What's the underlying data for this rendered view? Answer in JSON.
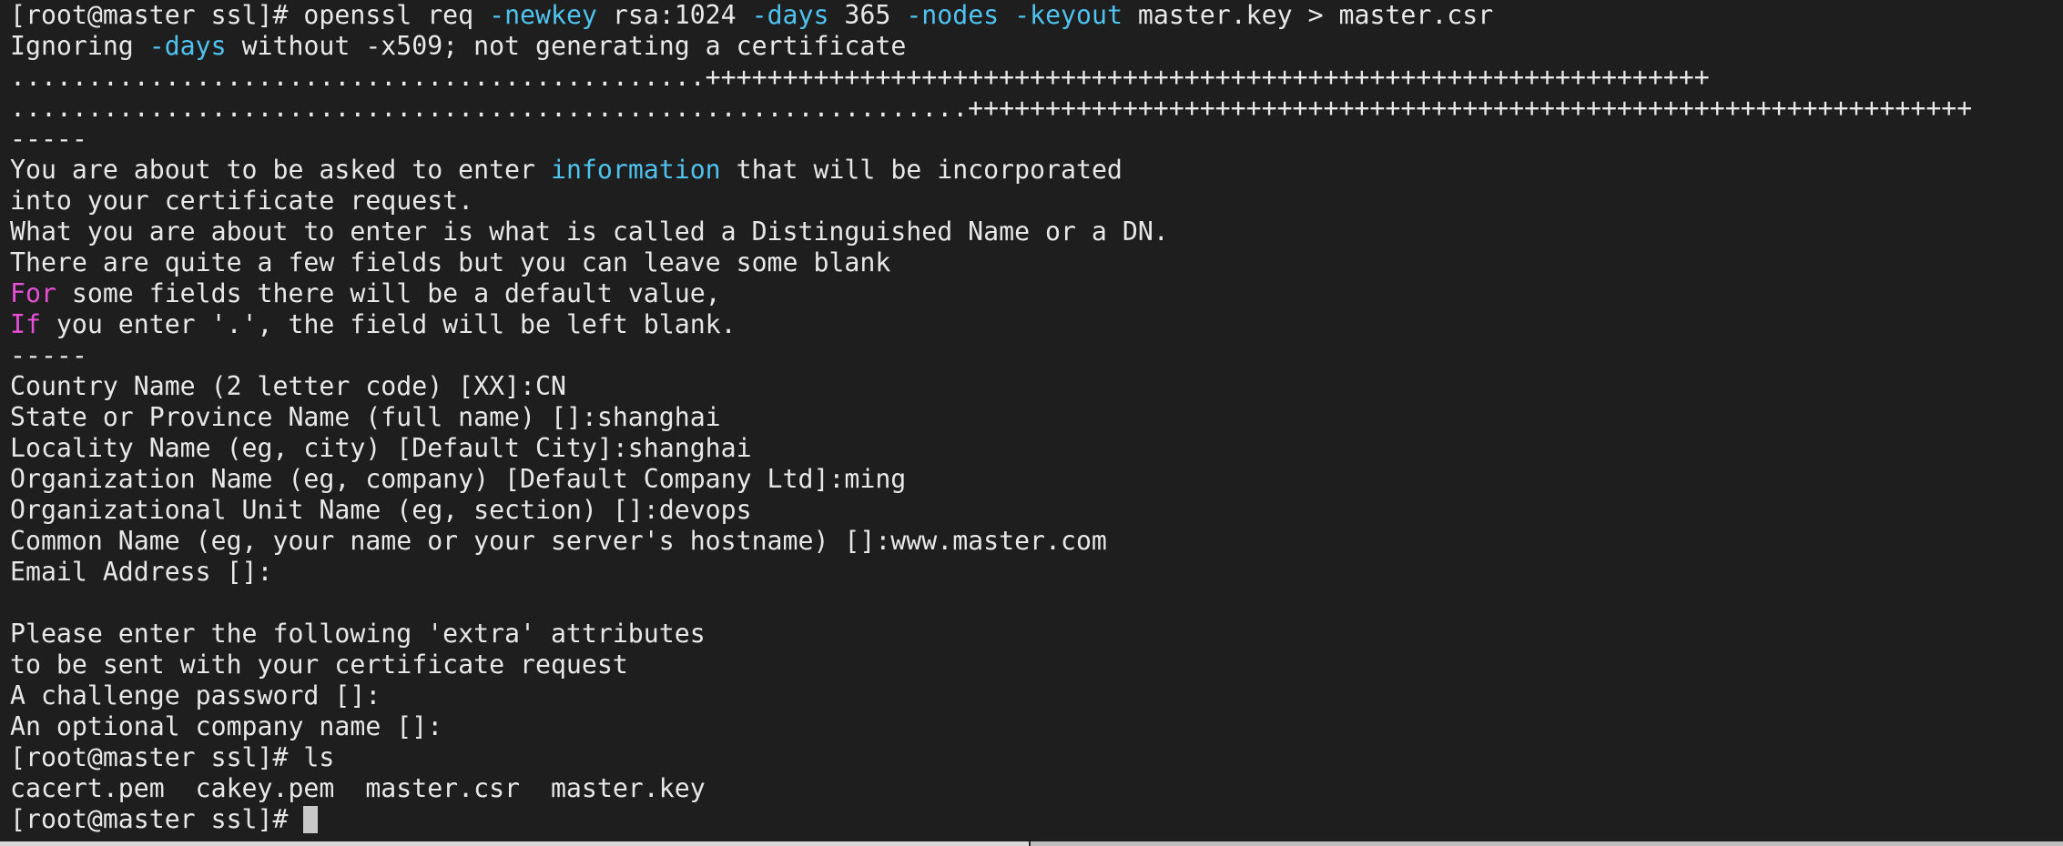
{
  "terminal": {
    "lines": [
      [
        [
          "n",
          "[root@master ssl]# openssl req "
        ],
        [
          "c",
          "-newkey"
        ],
        [
          "n",
          " rsa:1024 "
        ],
        [
          "c",
          "-days"
        ],
        [
          "n",
          " 365 "
        ],
        [
          "c",
          "-nodes"
        ],
        [
          "n",
          " "
        ],
        [
          "c",
          "-keyout"
        ],
        [
          "n",
          " master.key > master.csr"
        ]
      ],
      [
        [
          "n",
          "Ignoring "
        ],
        [
          "c",
          "-days"
        ],
        [
          "n",
          " without -x509; not generating a certificate"
        ]
      ],
      [
        [
          "n",
          ".............................................+++++++++++++++++++++++++++++++++++++++++++++++++++++++++++++++++"
        ]
      ],
      [
        [
          "n",
          "..............................................................+++++++++++++++++++++++++++++++++++++++++++++++++++++++++++++++++"
        ]
      ],
      [
        [
          "n",
          "-----"
        ]
      ],
      [
        [
          "n",
          "You are about to be asked to enter "
        ],
        [
          "c",
          "information"
        ],
        [
          "n",
          " that will be incorporated"
        ]
      ],
      [
        [
          "n",
          "into your certificate request."
        ]
      ],
      [
        [
          "n",
          "What you are about to enter is what is called a Distinguished Name or a DN."
        ]
      ],
      [
        [
          "n",
          "There are quite a few fields but you can leave some blank"
        ]
      ],
      [
        [
          "m",
          "For"
        ],
        [
          "n",
          " some fields there will be a default value,"
        ]
      ],
      [
        [
          "m",
          "If"
        ],
        [
          "n",
          " you enter '.', the field will be left blank."
        ]
      ],
      [
        [
          "n",
          "-----"
        ]
      ],
      [
        [
          "n",
          "Country Name (2 letter code) [XX]:CN"
        ]
      ],
      [
        [
          "n",
          "State or Province Name (full name) []:shanghai"
        ]
      ],
      [
        [
          "n",
          "Locality Name (eg, city) [Default City]:shanghai"
        ]
      ],
      [
        [
          "n",
          "Organization Name (eg, company) [Default Company Ltd]:ming"
        ]
      ],
      [
        [
          "n",
          "Organizational Unit Name (eg, section) []:devops"
        ]
      ],
      [
        [
          "n",
          "Common Name (eg, your name or your server's hostname) []:www.master.com"
        ]
      ],
      [
        [
          "n",
          "Email Address []:"
        ]
      ],
      [
        [
          "n",
          ""
        ]
      ],
      [
        [
          "n",
          "Please enter the following 'extra' attributes"
        ]
      ],
      [
        [
          "n",
          "to be sent with your certificate request"
        ]
      ],
      [
        [
          "n",
          "A challenge password []:"
        ]
      ],
      [
        [
          "n",
          "An optional company name []:"
        ]
      ],
      [
        [
          "n",
          "[root@master ssl]# ls"
        ]
      ],
      [
        [
          "n",
          "cacert.pem  cakey.pem  master.csr  master.key"
        ]
      ]
    ],
    "prompt": "[root@master ssl]# ",
    "colors": {
      "background": "#1e1e1e",
      "foreground": "#e8e8e8",
      "option": "#4fc3ef",
      "keyword": "#e64fd6",
      "cursor": "#c8c8c8"
    }
  }
}
